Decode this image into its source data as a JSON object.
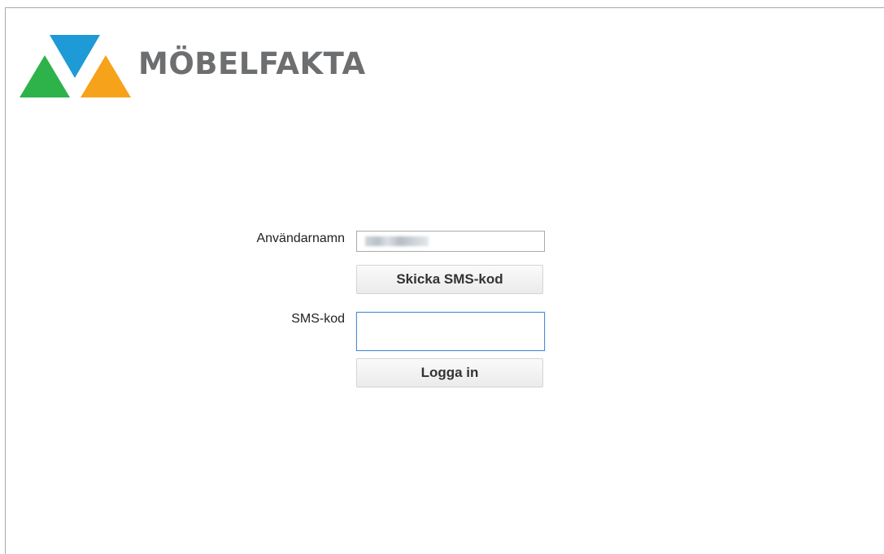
{
  "brand": {
    "name": "MÖBELFAKTA",
    "colors": {
      "blue": "#1e9ad6",
      "green": "#2db34a",
      "orange": "#f7a21b",
      "text": "#6d6e70"
    }
  },
  "login_form": {
    "username_label": "Användarnamn",
    "username_value": "",
    "send_sms_button": "Skicka SMS-kod",
    "sms_label": "SMS-kod",
    "sms_value": "",
    "login_button": "Logga in"
  }
}
